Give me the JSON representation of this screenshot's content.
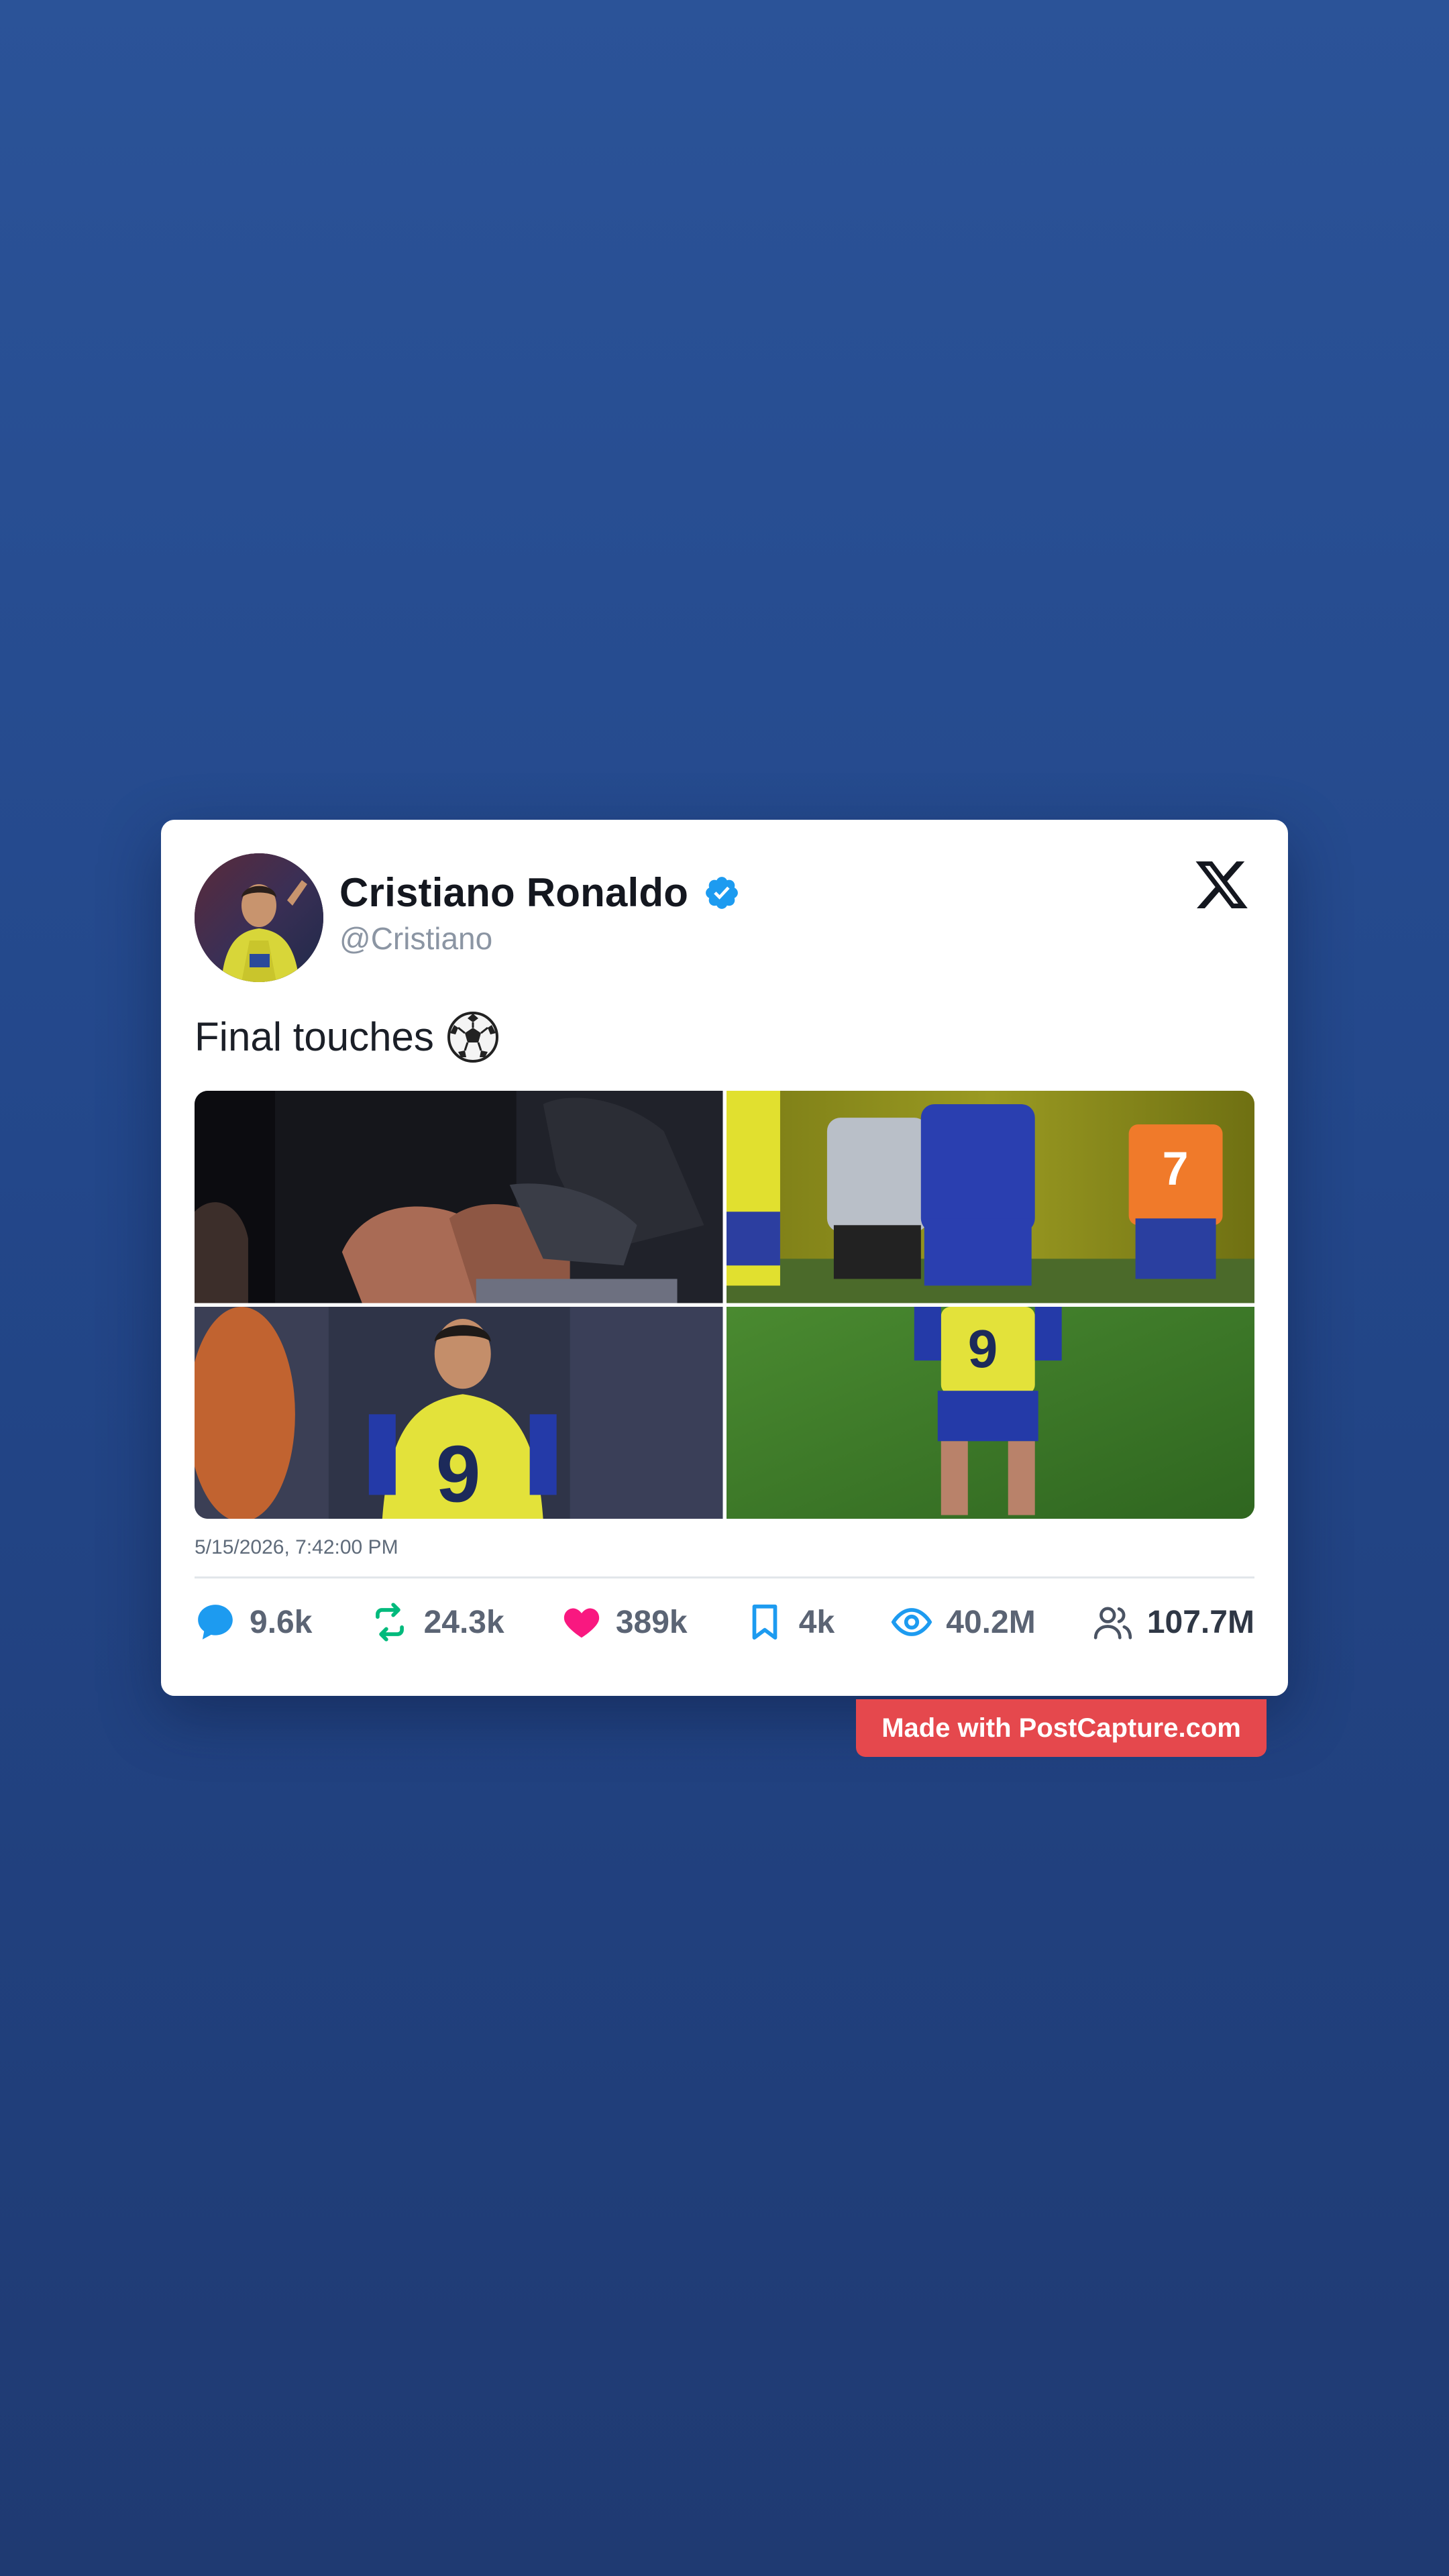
{
  "post": {
    "author_name": "Cristiano Ronaldo",
    "handle": "@Cristiano",
    "text": "Final touches",
    "emoji_icon": "soccer-ball-icon",
    "platform_icon": "x-logo-icon",
    "timestamp": "5/15/2026, 7:42:00 PM",
    "photos": [
      "photo-1",
      "photo-2",
      "photo-3",
      "photo-4"
    ]
  },
  "stats": {
    "replies": "9.6k",
    "reposts": "24.3k",
    "likes": "389k",
    "bookmarks": "4k",
    "views": "40.2M",
    "followers": "107.7M"
  },
  "footer": {
    "watermark": "Made with PostCapture.com"
  },
  "colors": {
    "verified": "#1d9bf0",
    "reply": "#1d9bf0",
    "repost": "#00ba7c",
    "like": "#f91880",
    "bookmark": "#1d9bf0",
    "views": "#1d9bf0",
    "badge": "#e5484d"
  }
}
